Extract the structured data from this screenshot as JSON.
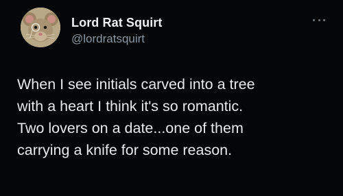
{
  "author": {
    "display_name": "Lord Rat Squirt",
    "handle": "@lordratsquirt",
    "avatar_icon": "rat-with-monocle-avatar"
  },
  "tweet": {
    "lines": [
      "When I see initials carved into a tree",
      "with a heart I think it's so romantic.",
      "Two lovers on a date...one of them",
      "carrying a knife for some reason."
    ]
  },
  "menu_icon": "more-options-icon",
  "colors": {
    "background": "#050607",
    "text_primary": "#e7e9ea",
    "text_secondary": "#8b98a5"
  }
}
